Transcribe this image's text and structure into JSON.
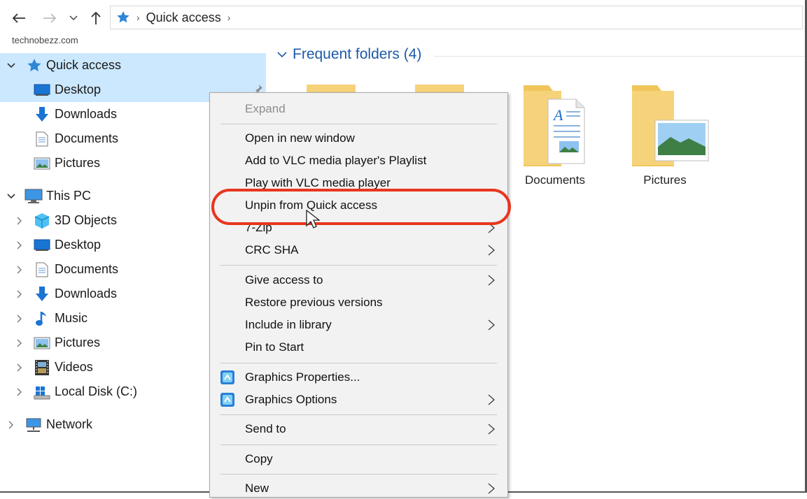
{
  "address_bar": {
    "crumbs": [
      "Quick access"
    ]
  },
  "watermark": "technobezz.com",
  "nav_pane": {
    "quick_access": {
      "label": "Quick access",
      "items": [
        "Desktop",
        "Downloads",
        "Documents",
        "Pictures"
      ]
    },
    "this_pc": {
      "label": "This PC",
      "items": [
        "3D Objects",
        "Desktop",
        "Documents",
        "Downloads",
        "Music",
        "Pictures",
        "Videos",
        "Local Disk (C:)"
      ]
    },
    "network": {
      "label": "Network"
    }
  },
  "content": {
    "group_title": "Frequent folders (4)",
    "folders": [
      "Documents",
      "Pictures"
    ]
  },
  "context_menu": {
    "items": [
      {
        "label": "Expand",
        "disabled": true
      },
      {
        "label": "Open in new window"
      },
      {
        "label": "Add to VLC media player's Playlist"
      },
      {
        "label": "Play with VLC media player"
      },
      {
        "label": "Unpin from Quick access",
        "highlighted": true
      },
      {
        "label": "7-Zip",
        "submenu": true
      },
      {
        "label": "CRC SHA",
        "submenu": true
      },
      {
        "label": "Give access to",
        "submenu": true
      },
      {
        "label": "Restore previous versions"
      },
      {
        "label": "Include in library",
        "submenu": true
      },
      {
        "label": "Pin to Start"
      },
      {
        "label": "Graphics Properties...",
        "icon": "intel-graphics-icon"
      },
      {
        "label": "Graphics Options",
        "icon": "intel-graphics-icon",
        "submenu": true
      },
      {
        "label": "Send to",
        "submenu": true
      },
      {
        "label": "Copy"
      },
      {
        "label": "New",
        "submenu": true
      }
    ]
  },
  "colors": {
    "selection": "#cce8ff",
    "accent_blue": "#1e5aa8",
    "highlight_ring": "#e8361f",
    "menu_bg": "#f2f2f2",
    "folder_yellow": "#f6d27a"
  }
}
